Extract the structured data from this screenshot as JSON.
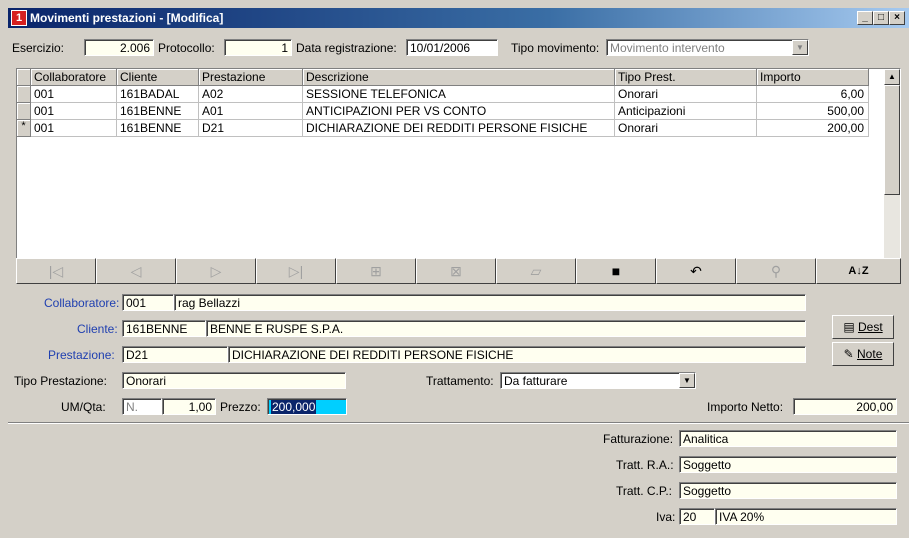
{
  "window": {
    "badge": "1",
    "title": "Movimenti prestazioni - [Modifica]"
  },
  "header": {
    "esercizio_label": "Esercizio:",
    "esercizio_value": "2.006",
    "protocollo_label": "Protocollo:",
    "protocollo_value": "1",
    "data_label": "Data registrazione:",
    "data_value": "10/01/2006",
    "tipo_label": "Tipo movimento:",
    "tipo_value": "Movimento intervento"
  },
  "grid": {
    "columns": [
      "Collaboratore",
      "Cliente",
      "Prestazione",
      "Descrizione",
      "Tipo Prest.",
      "Importo"
    ],
    "rows": [
      {
        "marker": "",
        "collaboratore": "001",
        "cliente": "161BADAL",
        "prestazione": "A02",
        "descrizione": "SESSIONE TELEFONICA",
        "tipo": "Onorari",
        "importo": "6,00"
      },
      {
        "marker": "",
        "collaboratore": "001",
        "cliente": "161BENNE",
        "prestazione": "A01",
        "descrizione": "ANTICIPAZIONI PER VS CONTO",
        "tipo": "Anticipazioni",
        "importo": "500,00"
      },
      {
        "marker": "*",
        "collaboratore": "001",
        "cliente": "161BENNE",
        "prestazione": "D21",
        "descrizione": "DICHIARAZIONE DEI REDDITI PERSONE FISICHE",
        "tipo": "Onorari",
        "importo": "200,00"
      }
    ]
  },
  "toolbar": {
    "icons": [
      "first-record-icon",
      "previous-record-icon",
      "next-record-icon",
      "last-record-icon",
      "add-record-icon",
      "delete-record-icon",
      "edit-record-icon",
      "save-icon",
      "undo-icon",
      "search-icon",
      "sort-az-icon"
    ],
    "glyphs": {
      "first": "|◁",
      "prev": "◁",
      "next": "▷",
      "last": "▷|",
      "add": "⊞",
      "delete": "⊠",
      "edit": "▱",
      "save": "■",
      "undo": "↶",
      "find": "⚲",
      "sort": "A↓Z"
    }
  },
  "form": {
    "collaboratore_label": "Collaboratore:",
    "collaboratore_code": "001",
    "collaboratore_name": "rag Bellazzi",
    "cliente_label": "Cliente:",
    "cliente_code": "161BENNE",
    "cliente_name": "BENNE E RUSPE S.P.A.",
    "prestazione_label": "Prestazione:",
    "prestazione_code": "D21",
    "prestazione_name": "DICHIARAZIONE DEI REDDITI PERSONE FISICHE",
    "tipo_prest_label": "Tipo Prestazione:",
    "tipo_prest_value": "Onorari",
    "trattamento_label": "Trattamento:",
    "trattamento_value": "Da fatturare",
    "umqta_label": "UM/Qta:",
    "um_value": "N.",
    "qta_value": "1,00",
    "prezzo_label": "Prezzo:",
    "prezzo_value": "200,000",
    "importo_label": "Importo Netto:",
    "importo_value": "200,00",
    "dest_button": "Dest",
    "note_button": "Note"
  },
  "footer": {
    "fatturazione_label": "Fatturazione:",
    "fatturazione_value": "Analitica",
    "ra_label": "Tratt. R.A.:",
    "ra_value": "Soggetto",
    "cp_label": "Tratt. C.P.:",
    "cp_value": "Soggetto",
    "iva_label": "Iva:",
    "iva_code": "20",
    "iva_desc": "IVA 20%"
  },
  "colors": {
    "title_gradient_start": "#0a246a",
    "field_bg": "#fffff0",
    "label_blue": "#1f3fb0",
    "selection": "#0a246a"
  }
}
